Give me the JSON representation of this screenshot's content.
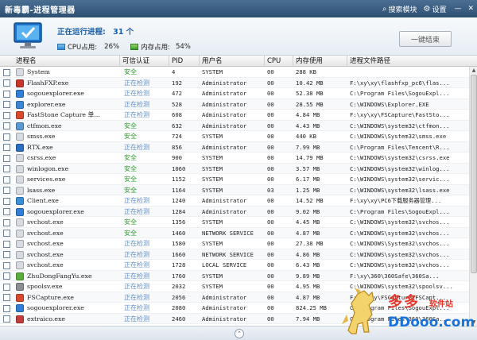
{
  "window": {
    "title": "新毒霸-进程管理器",
    "search_module": "搜索模块",
    "settings": "设置",
    "minimize": "—",
    "close": "✕"
  },
  "header": {
    "running_label": "正在运行进程:",
    "running_count": "31 个",
    "cpu_label": "CPU占用:",
    "cpu_value": "26%",
    "mem_label": "内存占用:",
    "mem_value": "54%",
    "end_button": "一键结束"
  },
  "columns": [
    "进程名",
    "可信认证",
    "PID",
    "用户名",
    "CPU",
    "内存使用",
    "进程文件路径"
  ],
  "rows": [
    {
      "name": "System",
      "status": "安全",
      "pid": "4",
      "user": "SYSTEM",
      "cpu": "00",
      "mem": "288 KB",
      "path": "",
      "icon": "#d7dce2"
    },
    {
      "name": "FlashFXP.exe",
      "status": "正在检测",
      "pid": "192",
      "user": "Administrator",
      "cpu": "00",
      "mem": "10.42 MB",
      "path": "F:\\xy\\xy\\flashfxp_pc6\\flas...",
      "icon": "#c7372c"
    },
    {
      "name": "sogouexplorer.exe",
      "status": "正在检测",
      "pid": "472",
      "user": "Administrator",
      "cpu": "00",
      "mem": "52.38 MB",
      "path": "C:\\Program Files\\SogouExpl...",
      "icon": "#2f7fd8"
    },
    {
      "name": "explorer.exe",
      "status": "正在检测",
      "pid": "528",
      "user": "Administrator",
      "cpu": "00",
      "mem": "28.55 MB",
      "path": "C:\\WINDOWS\\Explorer.EXE",
      "icon": "#3d86d6"
    },
    {
      "name": "FastStone Capture 单...",
      "status": "正在检测",
      "pid": "608",
      "user": "Administrator",
      "cpu": "00",
      "mem": "4.84 MB",
      "path": "F:\\xy\\xy\\FSCapture\\FastSto...",
      "icon": "#d84a2b"
    },
    {
      "name": "ctfmon.exe",
      "status": "安全",
      "pid": "632",
      "user": "Administrator",
      "cpu": "00",
      "mem": "4.43 MB",
      "path": "C:\\WINDOWS\\system32\\ctfmon...",
      "icon": "#5a9ad3"
    },
    {
      "name": "smss.exe",
      "status": "安全",
      "pid": "724",
      "user": "SYSTEM",
      "cpu": "00",
      "mem": "440 KB",
      "path": "C:\\WINDOWS\\System32\\smss.exe",
      "icon": "#d7dce2"
    },
    {
      "name": "RTX.exe",
      "status": "正在检测",
      "pid": "856",
      "user": "Administrator",
      "cpu": "00",
      "mem": "7.99 MB",
      "path": "C:\\Program Files\\Tencent\\R...",
      "icon": "#2a6fc4"
    },
    {
      "name": "csrss.exe",
      "status": "安全",
      "pid": "900",
      "user": "SYSTEM",
      "cpu": "00",
      "mem": "14.79 MB",
      "path": "C:\\WINDOWS\\system32\\csrss.exe",
      "icon": "#d7dce2"
    },
    {
      "name": "winlogon.exe",
      "status": "安全",
      "pid": "1060",
      "user": "SYSTEM",
      "cpu": "00",
      "mem": "3.57 MB",
      "path": "C:\\WINDOWS\\system32\\winlog...",
      "icon": "#d7dce2"
    },
    {
      "name": "services.exe",
      "status": "安全",
      "pid": "1152",
      "user": "SYSTEM",
      "cpu": "00",
      "mem": "6.17 MB",
      "path": "C:\\WINDOWS\\system32\\servic...",
      "icon": "#d7dce2"
    },
    {
      "name": "lsass.exe",
      "status": "安全",
      "pid": "1164",
      "user": "SYSTEM",
      "cpu": "03",
      "mem": "1.25 MB",
      "path": "C:\\WINDOWS\\system32\\lsass.exe",
      "icon": "#d7dce2"
    },
    {
      "name": "Client.exe",
      "status": "正在检测",
      "pid": "1240",
      "user": "Administrator",
      "cpu": "00",
      "mem": "14.52 MB",
      "path": "F:\\xy\\xy\\PC6下载服务器管理...",
      "icon": "#3a8fd9"
    },
    {
      "name": "sogouexplorer.exe",
      "status": "正在检测",
      "pid": "1284",
      "user": "Administrator",
      "cpu": "00",
      "mem": "9.02 MB",
      "path": "C:\\Program Files\\SogouExpl...",
      "icon": "#2f7fd8"
    },
    {
      "name": "svchost.exe",
      "status": "安全",
      "pid": "1356",
      "user": "SYSTEM",
      "cpu": "00",
      "mem": "4.45 MB",
      "path": "C:\\WINDOWS\\system32\\svchos...",
      "icon": "#d7dce2"
    },
    {
      "name": "svchost.exe",
      "status": "安全",
      "pid": "1460",
      "user": "NETWORK SERVICE",
      "cpu": "00",
      "mem": "4.87 MB",
      "path": "C:\\WINDOWS\\system32\\svchos...",
      "icon": "#d7dce2"
    },
    {
      "name": "svchost.exe",
      "status": "正在检测",
      "pid": "1580",
      "user": "SYSTEM",
      "cpu": "00",
      "mem": "27.38 MB",
      "path": "C:\\WINDOWS\\System32\\svchos...",
      "icon": "#d7dce2"
    },
    {
      "name": "svchost.exe",
      "status": "正在检测",
      "pid": "1660",
      "user": "NETWORK SERVICE",
      "cpu": "00",
      "mem": "4.86 MB",
      "path": "C:\\WINDOWS\\system32\\svchos...",
      "icon": "#d7dce2"
    },
    {
      "name": "svchost.exe",
      "status": "正在检测",
      "pid": "1728",
      "user": "LOCAL SERVICE",
      "cpu": "00",
      "mem": "6.43 MB",
      "path": "C:\\WINDOWS\\system32\\svchos...",
      "icon": "#d7dce2"
    },
    {
      "name": "ZhuDongFangYu.exe",
      "status": "正在检测",
      "pid": "1760",
      "user": "SYSTEM",
      "cpu": "00",
      "mem": "9.89 MB",
      "path": "F:\\xy\\360\\360Safe\\360Sa...",
      "icon": "#5cae3c"
    },
    {
      "name": "spoolsv.exe",
      "status": "正在检测",
      "pid": "2032",
      "user": "SYSTEM",
      "cpu": "00",
      "mem": "4.95 MB",
      "path": "C:\\WINDOWS\\system32\\spoolsv...",
      "icon": "#8a8f96"
    },
    {
      "name": "FSCapture.exe",
      "status": "正在检测",
      "pid": "2056",
      "user": "Administrator",
      "cpu": "00",
      "mem": "4.87 MB",
      "path": "F:\\xy\\xy\\FSCapture\\FSCapt...",
      "icon": "#d84a2b"
    },
    {
      "name": "sogouexplorer.exe",
      "status": "正在检测",
      "pid": "2080",
      "user": "Administrator",
      "cpu": "00",
      "mem": "824.25 MB",
      "path": "C:\\Program Files\\SogouExpl...",
      "icon": "#2f7fd8"
    },
    {
      "name": "extraico.exe",
      "status": "正在检测",
      "pid": "2460",
      "user": "Administrator",
      "cpu": "00",
      "mem": "7.94 MB",
      "path": "C:\\Program Files\\360\\360Sa...",
      "icon": "#c43b3b"
    }
  ],
  "watermark": {
    "brand": "多多",
    "sub": "软件站",
    "domain": "DDooo.com"
  },
  "colors": {
    "safe": "#2a9a2a",
    "checking": "#5b8fc9",
    "title_bg": "#2d4f72",
    "accent": "#1b5fa8"
  }
}
